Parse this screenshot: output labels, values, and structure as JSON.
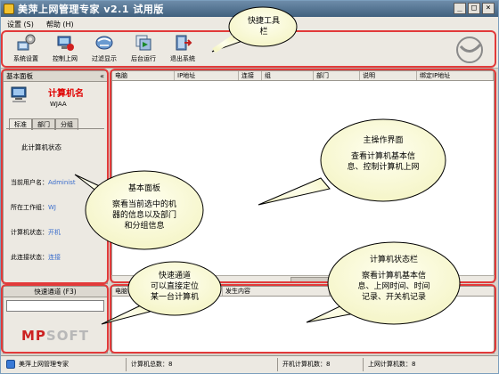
{
  "window": {
    "title": "美萍上网管理专家 v2.1 试用版",
    "buttons": [
      "_",
      "□",
      "×"
    ]
  },
  "menu": {
    "items": [
      "设置 (S)",
      "帮助 (H)"
    ]
  },
  "toolbar": {
    "buttons": [
      {
        "label": "系统设置",
        "icon": "settings-icon"
      },
      {
        "label": "控制上网",
        "icon": "network-control-icon"
      },
      {
        "label": "过滤显示",
        "icon": "filter-icon"
      },
      {
        "label": "后台运行",
        "icon": "background-run-icon"
      },
      {
        "label": "退出系统",
        "icon": "exit-icon"
      }
    ]
  },
  "basic_panel": {
    "header": "基本面板",
    "collapse": "«",
    "computer_name": "计算机名",
    "computer_ip": "WJAA",
    "tabs": [
      "标准",
      "部门",
      "分组"
    ],
    "status_title": "此计算机状态",
    "rows": [
      {
        "label": "当前用户名：",
        "value": "Administ"
      },
      {
        "label": "所在工作组：",
        "value": "WJ"
      },
      {
        "label": "计算机状态：",
        "value": "开机"
      },
      {
        "label": "此连接状态：",
        "value": "连接"
      }
    ]
  },
  "quick_panel": {
    "header": "快速通道 (F3)",
    "logo_mp": "MP",
    "logo_soft": "SOFT"
  },
  "main_list": {
    "columns": [
      "电脑",
      "IP地址",
      "连接",
      "组",
      "部门",
      "说明",
      "绑定IP地址"
    ]
  },
  "status_list": {
    "columns": [
      "电脑",
      "",
      "发生内容"
    ]
  },
  "statusbar": {
    "app": "美萍上网管理专家",
    "total": "计算机总数：8",
    "online": "开机计算机数：8",
    "net": "上网计算机数：8"
  },
  "annotations": {
    "toolbar": [
      "快捷工具",
      "栏"
    ],
    "main": [
      "主操作界面",
      "",
      "查看计算机基本信",
      "息、控制计算机上网"
    ],
    "basic": [
      "基本面板",
      "",
      "察看当前选中的机",
      "器的信息以及部门",
      "和分组信息"
    ],
    "quick": [
      "快速通道",
      "可以直接定位",
      "某一台计算机"
    ],
    "status": [
      "计算机状态栏",
      "",
      "察看计算机基本信",
      "息、上网时间、时间",
      "记录、开关机记录"
    ]
  },
  "colors": {
    "annotation_red": "#e23a3a",
    "title_bar": "#40607e",
    "computer_name": "#e00000",
    "value_blue": "#3a6dcc",
    "logo_red": "#cc2222"
  }
}
